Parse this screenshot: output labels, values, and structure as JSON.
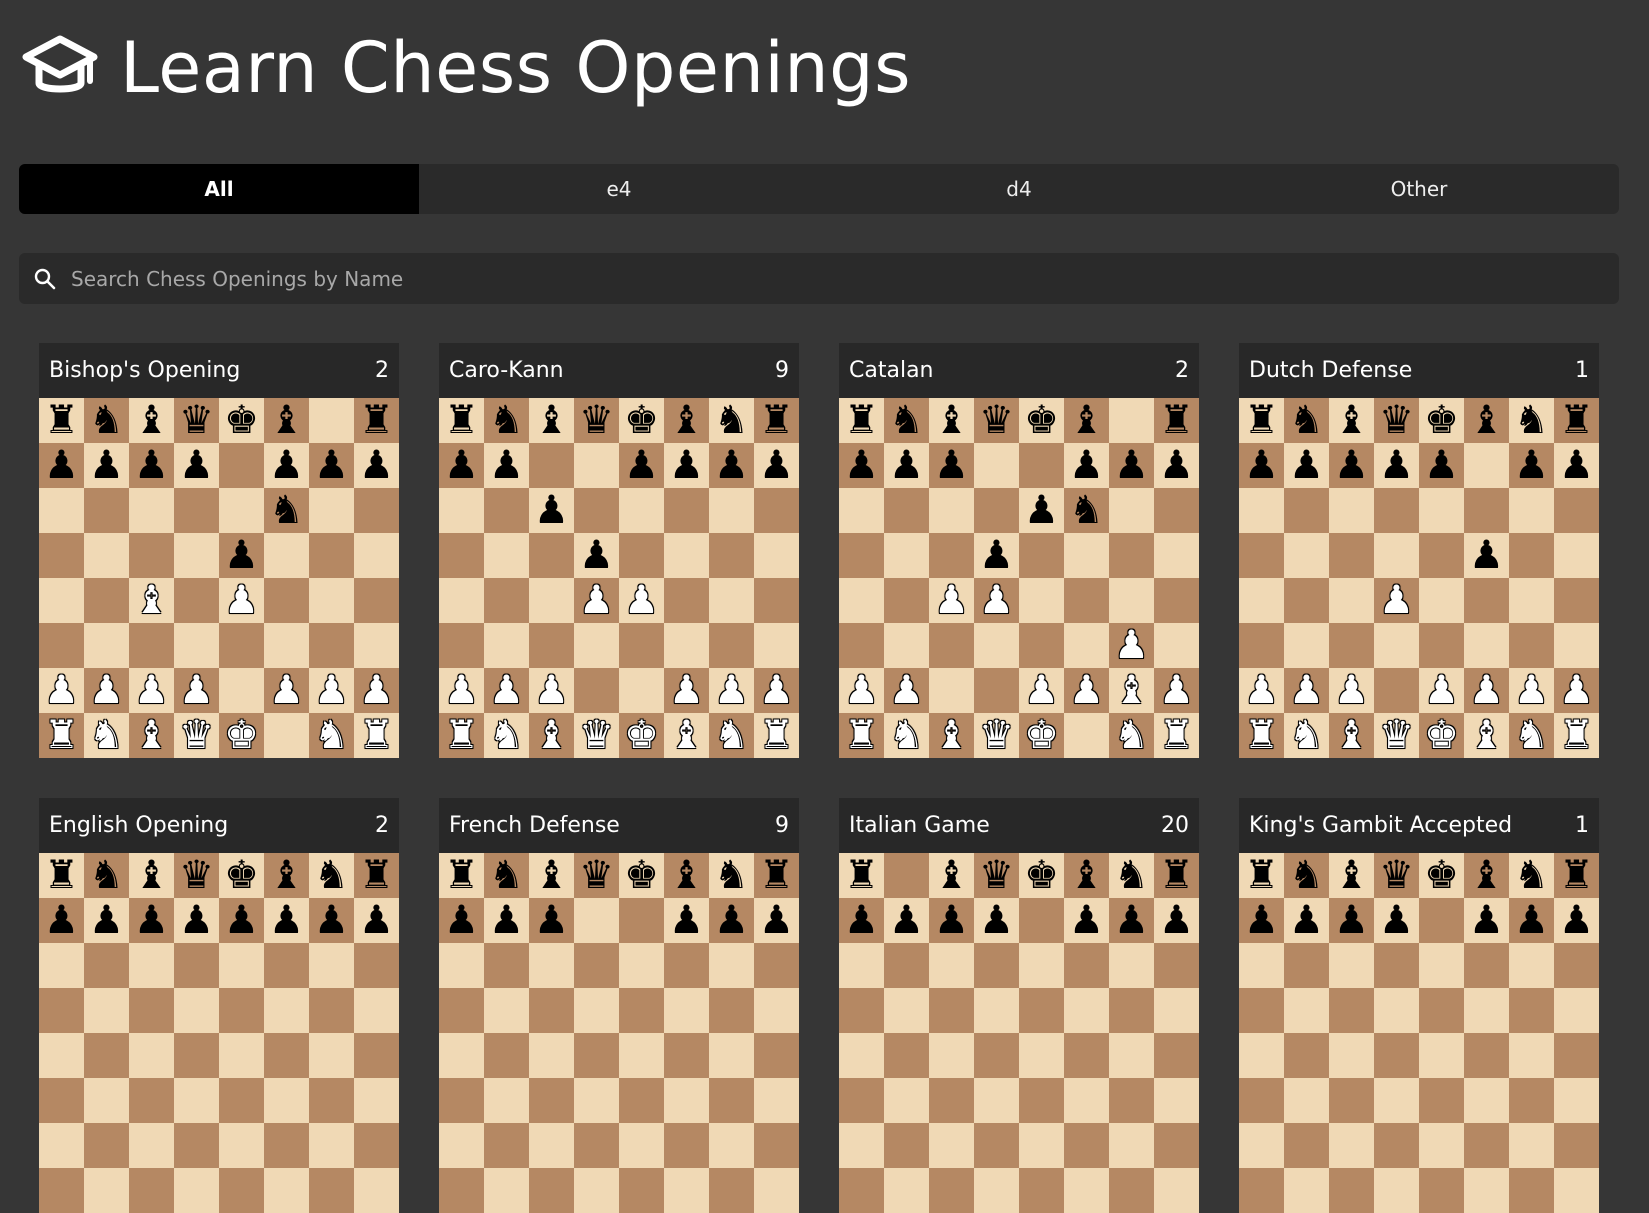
{
  "header": {
    "title": "Learn Chess Openings",
    "icon": "graduation-cap-icon"
  },
  "tabs": [
    {
      "label": "All",
      "active": true
    },
    {
      "label": "e4",
      "active": false
    },
    {
      "label": "d4",
      "active": false
    },
    {
      "label": "Other",
      "active": false
    }
  ],
  "search": {
    "placeholder": "Search Chess Openings by Name",
    "value": "",
    "icon": "search-icon"
  },
  "colors": {
    "background": "#363636",
    "light_square": "#f0d9b5",
    "dark_square": "#b58863",
    "active_tab": "#000000"
  },
  "openings": [
    {
      "name": "Bishop's Opening",
      "count": "2",
      "fen": [
        "rnbqkb1r",
        "pppp1ppp",
        "5n2",
        "4p3",
        "2B1P3",
        "8",
        "PPPP1PPP",
        "RNBQK1NR"
      ]
    },
    {
      "name": "Caro-Kann",
      "count": "9",
      "fen": [
        "rnbqkbnr",
        "pp2pppp",
        "2p5",
        "3p4",
        "3PP3",
        "8",
        "PPP2PPP",
        "RNBQKBNR"
      ]
    },
    {
      "name": "Catalan",
      "count": "2",
      "fen": [
        "rnbqkb1r",
        "ppp2ppp",
        "4pn2",
        "3p4",
        "2PP4",
        "6P1",
        "PP2PPBP",
        "RNBQK1NR"
      ]
    },
    {
      "name": "Dutch Defense",
      "count": "1",
      "fen": [
        "rnbqkbnr",
        "ppppp1pp",
        "8",
        "5p2",
        "3P4",
        "8",
        "PPP1PPPP",
        "RNBQKBNR"
      ]
    },
    {
      "name": "English Opening",
      "count": "2",
      "fen": [
        "rnbqkbnr",
        "pppppppp",
        "8",
        "8",
        "8",
        "8",
        "8",
        "8"
      ]
    },
    {
      "name": "French Defense",
      "count": "9",
      "fen": [
        "rnbqkbnr",
        "ppp2ppp",
        "8",
        "8",
        "8",
        "8",
        "8",
        "8"
      ]
    },
    {
      "name": "Italian Game",
      "count": "20",
      "fen": [
        "r1bqkbnr",
        "pppp1ppp",
        "8",
        "8",
        "8",
        "8",
        "8",
        "8"
      ]
    },
    {
      "name": "King's Gambit Accepted",
      "count": "1",
      "fen": [
        "rnbqkbnr",
        "pppp1ppp",
        "8",
        "8",
        "8",
        "8",
        "8",
        "8"
      ]
    }
  ]
}
